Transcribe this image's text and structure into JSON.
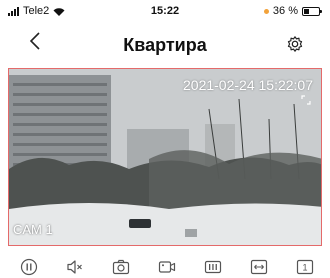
{
  "status_bar": {
    "carrier": "Tele2",
    "time": "15:22",
    "battery": "36 %",
    "battery_level": 0.36
  },
  "nav": {
    "title": "Квартира",
    "back_icon": "chevron-left-icon",
    "settings_icon": "gear-icon"
  },
  "camera": {
    "timestamp": "2021-02-24 15:22:07",
    "label": "CAM 1"
  },
  "controls": [
    {
      "name": "pause-button",
      "icon": "pause-icon"
    },
    {
      "name": "mute-button",
      "icon": "speaker-mute-icon"
    },
    {
      "name": "snapshot-button",
      "icon": "camera-icon"
    },
    {
      "name": "record-button",
      "icon": "video-record-icon"
    },
    {
      "name": "quality-button",
      "icon": "bars-icon"
    },
    {
      "name": "fit-button",
      "icon": "stretch-icon"
    },
    {
      "name": "channel-button",
      "icon": "number-one-icon",
      "text": "1"
    }
  ],
  "colors": {
    "accent_border": "#e46a6a",
    "battery_dot": "#f2a23a"
  }
}
